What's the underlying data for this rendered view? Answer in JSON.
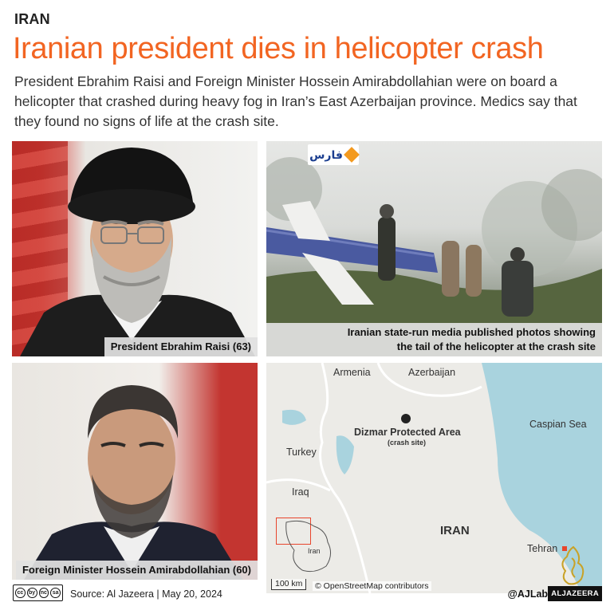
{
  "kicker": "IRAN",
  "headline": "Iranian president dies in helicopter crash",
  "deck": "President Ebrahim Raisi and Foreign Minister Hossein Amirabdollahian were on board a helicopter that crashed during heavy fog in Iran’s East Azerbaijan province. Medics say that they found no signs of life at the crash site.",
  "panels": {
    "raisi_caption": "President Ebrahim Raisi (63)",
    "crash_caption_line1": "Iranian state-run media published photos showing",
    "crash_caption_line2": "the tail of the helicopter at the crash site",
    "fars_logo_text": "فارس",
    "fm_caption": "Foreign Minister Hossein Amirabdollahian (60)"
  },
  "map": {
    "labels": {
      "armenia": "Armenia",
      "azerbaijan": "Azerbaijan",
      "caspian": "Caspian Sea",
      "turkey": "Turkey",
      "iraq": "Iraq",
      "iran": "IRAN",
      "tehran": "Tehran",
      "site": "Dizmar Protected Area",
      "site_sub": "(crash site)",
      "inset_iran": "Iran"
    },
    "scale": "100 km",
    "attribution": "© OpenStreetMap contributors",
    "colors": {
      "water": "#a9d3de",
      "land": "#ecebe7",
      "border": "#ffffff",
      "marker": "#e8452c",
      "inset": "#e8452c"
    }
  },
  "footer": {
    "license": [
      "cc",
      "by",
      "nc",
      "sa"
    ],
    "source": "Source: Al Jazeera  |  May 20, 2024",
    "handle": "@AJLabs",
    "brand": "ALJAZEERA"
  },
  "colors": {
    "headline": "#f26522"
  }
}
